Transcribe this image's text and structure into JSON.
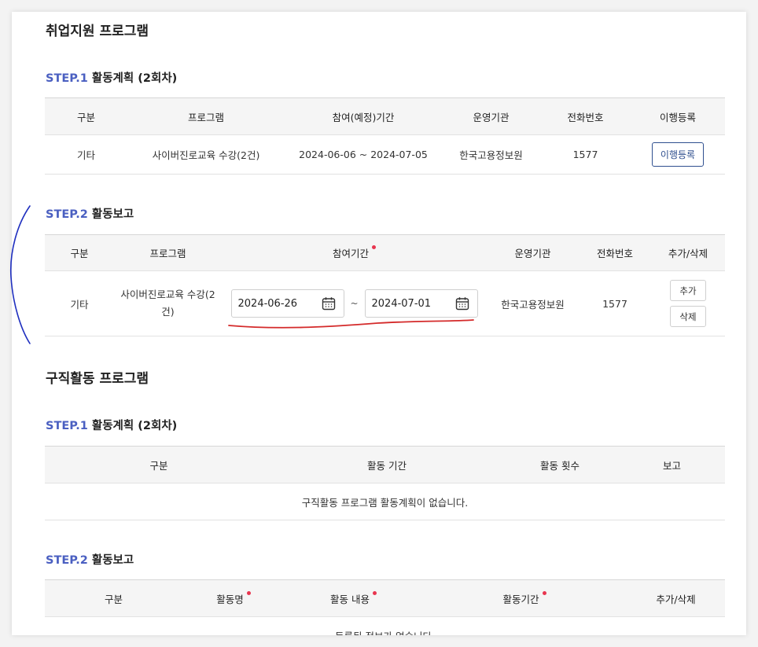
{
  "employment": {
    "title": "취업지원 프로그램",
    "step1": {
      "num": "STEP.1",
      "label": "활동계획 (2회차)",
      "headers": [
        "구분",
        "프로그램",
        "참여(예정)기간",
        "운영기관",
        "전화번호",
        "이행등록"
      ],
      "row": {
        "type": "기타",
        "program": "사이버진로교육 수강(2건)",
        "period": "2024-06-06 ~ 2024-07-05",
        "org": "한국고용정보원",
        "phone": "1577",
        "action": "이행등록"
      }
    },
    "step2": {
      "num": "STEP.2",
      "label": "활동보고",
      "headers": [
        "구분",
        "프로그램",
        "참여기간",
        "운영기관",
        "전화번호",
        "추가/삭제"
      ],
      "row": {
        "type": "기타",
        "program_line1": "사이버진로교육 수강(2",
        "program_line2": "건)",
        "start_date": "2024-06-26",
        "end_date": "2024-07-01",
        "tilde": "~",
        "org": "한국고용정보원",
        "phone": "1577",
        "add": "추가",
        "delete": "삭제"
      }
    }
  },
  "jobsearch": {
    "title": "구직활동 프로그램",
    "step1": {
      "num": "STEP.1",
      "label": "활동계획 (2회차)",
      "headers": [
        "구분",
        "활동 기간",
        "활동 횟수",
        "보고"
      ],
      "empty": "구직활동 프로그램 활동계획이 없습니다."
    },
    "step2": {
      "num": "STEP.2",
      "label": "활동보고",
      "headers": [
        "구분",
        "활동명",
        "활동 내용",
        "활동기간",
        "추가/삭제"
      ],
      "empty": "등록된 정보가 없습니다."
    }
  },
  "colors": {
    "step_accent": "#4a5fc1",
    "required_dot": "#e8354f",
    "button_border": "#2f4f8f",
    "underline_annotation": "#d42a2a",
    "bracket_annotation": "#1f2fbf"
  }
}
